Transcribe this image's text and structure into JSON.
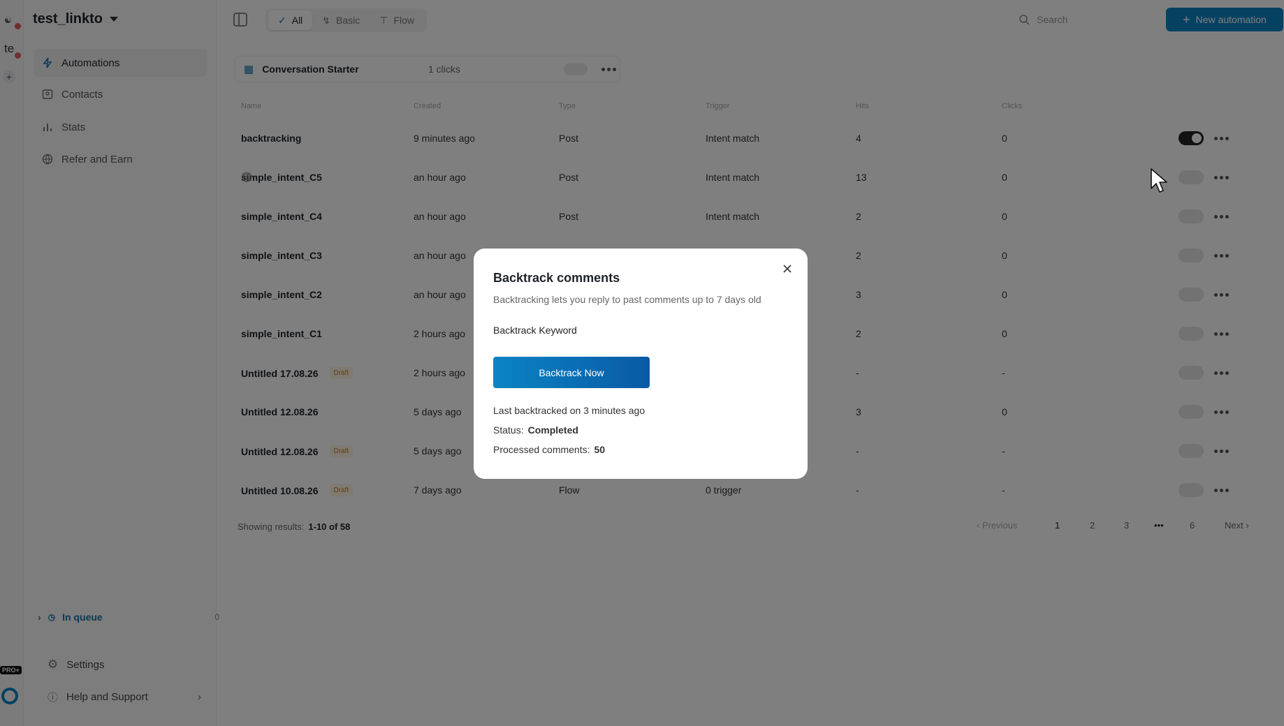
{
  "rail": {
    "ws1": "",
    "ws2": "te",
    "pro_badge": "PRO+"
  },
  "sidebar": {
    "workspace": "test_linkto",
    "nav": [
      {
        "label": "Automations",
        "icon": "bolt-icon"
      },
      {
        "label": "Contacts",
        "icon": "contact-card-icon"
      },
      {
        "label": "Stats",
        "icon": "bar-chart-icon"
      },
      {
        "label": "Refer and Earn",
        "icon": "globe-icon"
      }
    ],
    "queue_label": "In queue",
    "queue_count": "0",
    "settings": "Settings",
    "help": "Help and Support"
  },
  "toolbar": {
    "tabs": [
      {
        "label": "All",
        "icon": "check-icon"
      },
      {
        "label": "Basic",
        "icon": "bolt-icon"
      },
      {
        "label": "Flow",
        "icon": "flow-icon"
      }
    ],
    "search_placeholder": "Search",
    "new_button": "New automation"
  },
  "pinned": {
    "title": "Conversation Starter",
    "clicks": "1 clicks"
  },
  "table": {
    "headers": [
      "Name",
      "Created",
      "Type",
      "Trigger",
      "Hits",
      "Clicks"
    ],
    "rows": [
      {
        "name": "backtracking",
        "created": "9 minutes ago",
        "type": "Post",
        "trigger": "Intent match",
        "hits": "4",
        "clicks": "0",
        "draft": false,
        "active": true,
        "globe": false
      },
      {
        "name": "simple_intent_C5",
        "created": "an hour ago",
        "type": "Post",
        "trigger": "Intent match",
        "hits": "13",
        "clicks": "0",
        "draft": false,
        "active": false,
        "globe": true
      },
      {
        "name": "simple_intent_C4",
        "created": "an hour ago",
        "type": "Post",
        "trigger": "Intent match",
        "hits": "2",
        "clicks": "0",
        "draft": false,
        "active": false,
        "globe": false
      },
      {
        "name": "simple_intent_C3",
        "created": "an hour ago",
        "type": "",
        "trigger": "",
        "hits": "2",
        "clicks": "0",
        "draft": false,
        "active": false,
        "globe": false
      },
      {
        "name": "simple_intent_C2",
        "created": "an hour ago",
        "type": "",
        "trigger": "",
        "hits": "3",
        "clicks": "0",
        "draft": false,
        "active": false,
        "globe": false
      },
      {
        "name": "simple_intent_C1",
        "created": "2 hours ago",
        "type": "",
        "trigger": "",
        "hits": "2",
        "clicks": "0",
        "draft": false,
        "active": false,
        "globe": false
      },
      {
        "name": "Untitled 17.08.26",
        "created": "2 hours ago",
        "type": "",
        "trigger": "",
        "hits": "-",
        "clicks": "-",
        "draft": true,
        "active": false,
        "globe": false
      },
      {
        "name": "Untitled 12.08.26",
        "created": "5 days ago",
        "type": "",
        "trigger": "",
        "hits": "3",
        "clicks": "0",
        "draft": false,
        "active": false,
        "globe": false
      },
      {
        "name": "Untitled 12.08.26",
        "created": "5 days ago",
        "type": "",
        "trigger": "",
        "hits": "-",
        "clicks": "-",
        "draft": true,
        "active": false,
        "globe": false
      },
      {
        "name": "Untitled 10.08.26",
        "created": "7 days ago",
        "type": "Flow",
        "trigger": "0 trigger",
        "hits": "-",
        "clicks": "-",
        "draft": true,
        "active": false,
        "globe": false
      }
    ],
    "draft_label": "Draft"
  },
  "footer": {
    "showing_label": "Showing results:",
    "showing_value": "1-10 of 58",
    "prev": "Previous",
    "pages": [
      "1",
      "2",
      "3",
      "6"
    ],
    "ellipsis": "•••",
    "next": "Next"
  },
  "modal": {
    "title": "Backtrack comments",
    "subtitle": "Backtracking lets you reply to past comments up to 7 days old",
    "keyword_label": "Backtrack Keyword",
    "button": "Backtrack Now",
    "last_backtracked": "Last backtracked on 3 minutes ago",
    "status_label": "Status:",
    "status_value": "Completed",
    "processed_label": "Processed comments:",
    "processed_value": "50"
  }
}
